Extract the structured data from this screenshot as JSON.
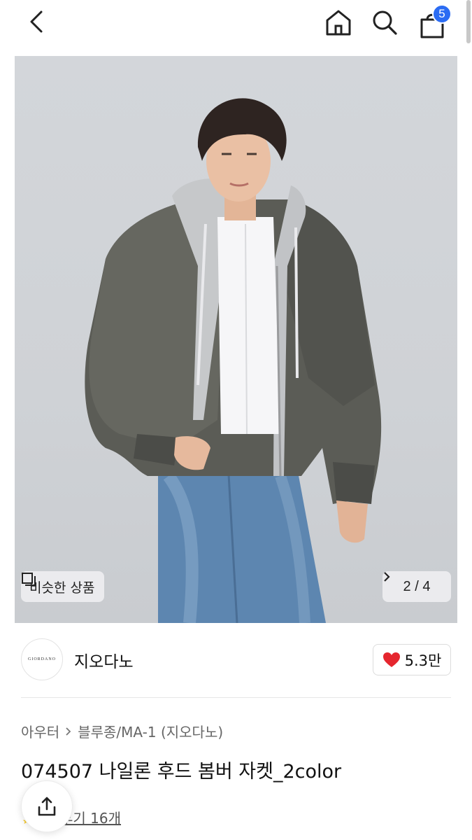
{
  "header": {
    "cart_count": "5"
  },
  "hero": {
    "similar_label": "비슷한 상품",
    "pager_text": "2 / 4"
  },
  "brand": {
    "logo_text": "GIORDANO",
    "name": "지오다노",
    "likes": "5.3만"
  },
  "product": {
    "breadcrumb": [
      "아우터",
      "블루종/MA-1 (지오다노)"
    ],
    "title": "074507 나일론 후드 봄버 자켓_2color",
    "reviews_label": "후기 16개"
  },
  "colors": {
    "accent": "#2b6cf3",
    "heart": "#e5262e"
  },
  "icons": [
    "back-icon",
    "home-icon",
    "search-icon",
    "cart-icon",
    "similar-icon",
    "chevron-right-icon",
    "heart-icon",
    "share-icon"
  ]
}
